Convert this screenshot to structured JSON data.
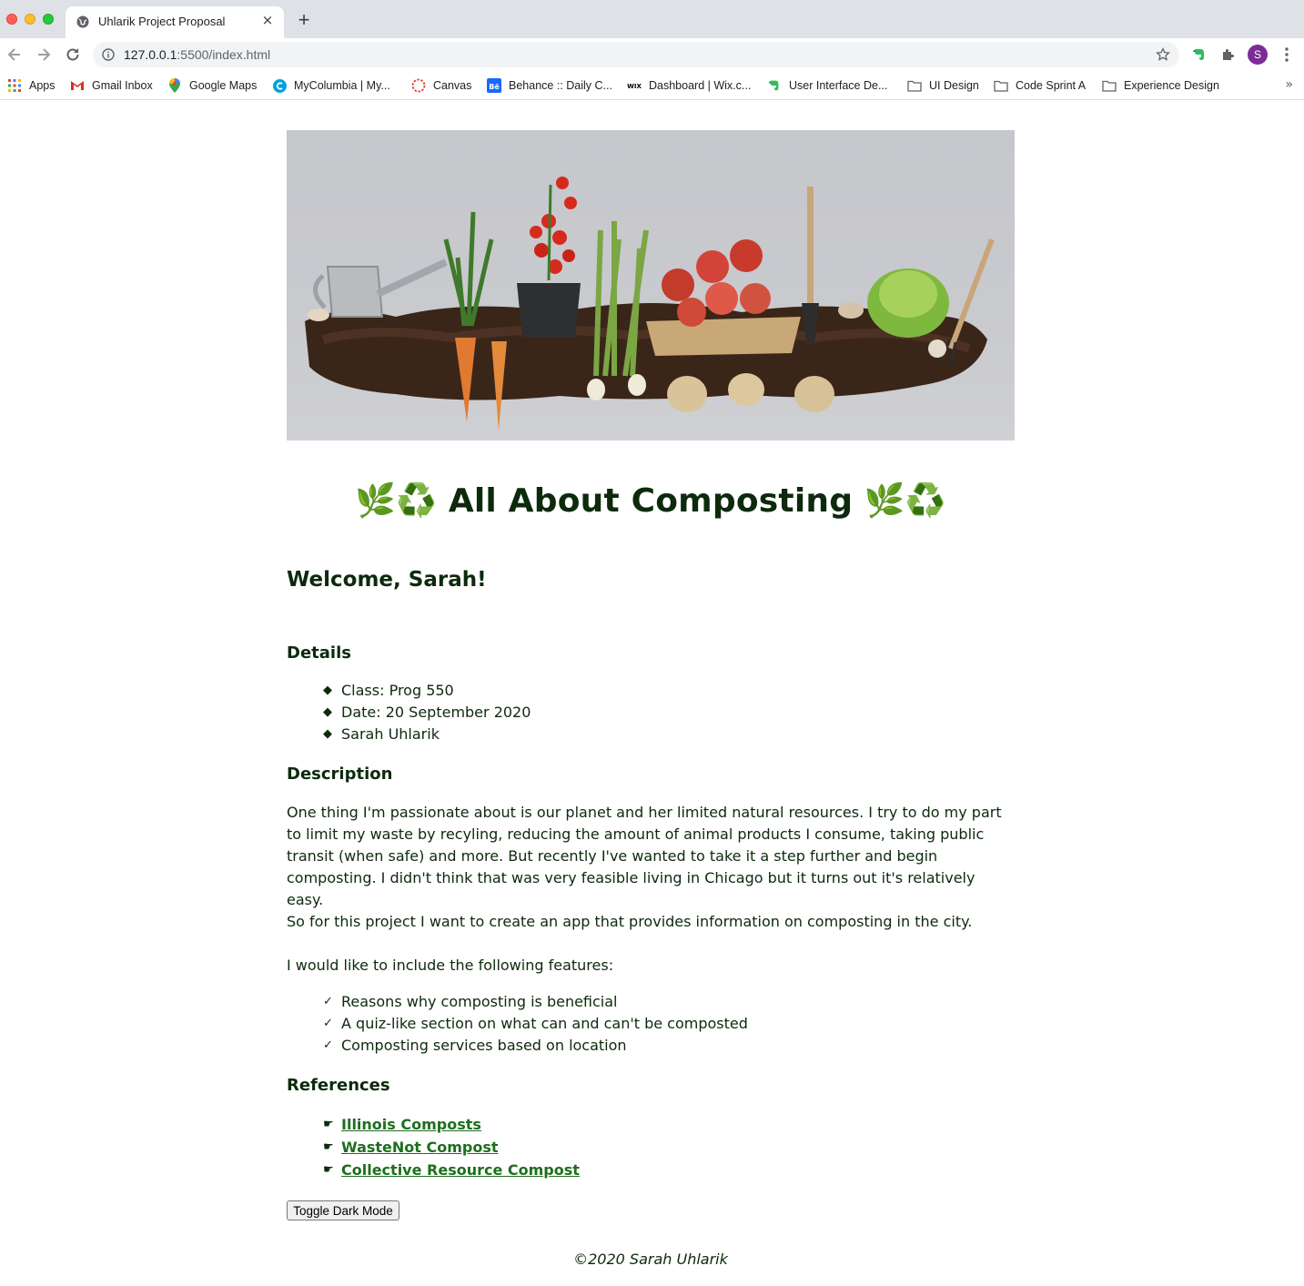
{
  "browser": {
    "tab_title": "Uhlarik Project Proposal",
    "tab_close": "×",
    "new_tab": "+",
    "url_host": "127.0.0.1",
    "url_rest": ":5500/index.html",
    "avatar_letter": "S",
    "bookmarks": [
      {
        "label": "Apps",
        "icon": "apps-grid-icon"
      },
      {
        "label": "Gmail Inbox",
        "icon": "gmail-icon"
      },
      {
        "label": "Google Maps",
        "icon": "maps-pin-icon"
      },
      {
        "label": "MyColumbia | My...",
        "icon": "mycolumbia-icon"
      },
      {
        "label": "Canvas",
        "icon": "canvas-icon"
      },
      {
        "label": "Behance :: Daily C...",
        "icon": "behance-icon"
      },
      {
        "label": "Dashboard | Wix.c...",
        "icon": "wix-icon"
      },
      {
        "label": "User Interface De...",
        "icon": "evernote-icon"
      },
      {
        "label": "UI Design",
        "icon": "folder-icon"
      },
      {
        "label": "Code Sprint A",
        "icon": "folder-icon"
      },
      {
        "label": "Experience Design",
        "icon": "folder-icon"
      }
    ],
    "bookmarks_more": "»",
    "colors": {
      "tabstrip": "#dee1e6",
      "omnibox": "#f1f3f4",
      "avatar": "#7b2d96"
    }
  },
  "page": {
    "hero_image": "composting-vegetables-soil-image",
    "title": "🌿♻️ All About Composting 🌿♻️",
    "welcome": "Welcome, Sarah!",
    "details_heading": "Details",
    "details": [
      "Class: Prog 550",
      "Date: 20 September 2020",
      "Sarah Uhlarik"
    ],
    "details_bullet": "◆",
    "description_heading": "Description",
    "description_paragraphs": [
      "One thing I'm passionate about is our planet and her limited natural resources. I try to do my part to limit my waste by recyling, reducing the amount of animal products I consume, taking public transit (when safe) and more. But recently I've wanted to take it a step further and begin composting. I didn't think that was very feasible living in Chicago but it turns out it's relatively easy.",
      "So for this project I want to create an app that provides information on composting in the city.",
      "I would like to include the following features:"
    ],
    "features_bullet": "✓",
    "features": [
      "Reasons why composting is beneficial",
      "A quiz-like section on what can and can't be composted",
      "Composting services based on location"
    ],
    "references_heading": "References",
    "references_bullet": "☛",
    "references": [
      "Illinois Composts",
      "WasteNot Compost",
      "Collective Resource Compost"
    ],
    "toggle_label": "Toggle Dark Mode",
    "footer": "©2020 Sarah Uhlarik",
    "colors": {
      "text": "#0d2a0c",
      "link": "#1f6e1f"
    }
  }
}
